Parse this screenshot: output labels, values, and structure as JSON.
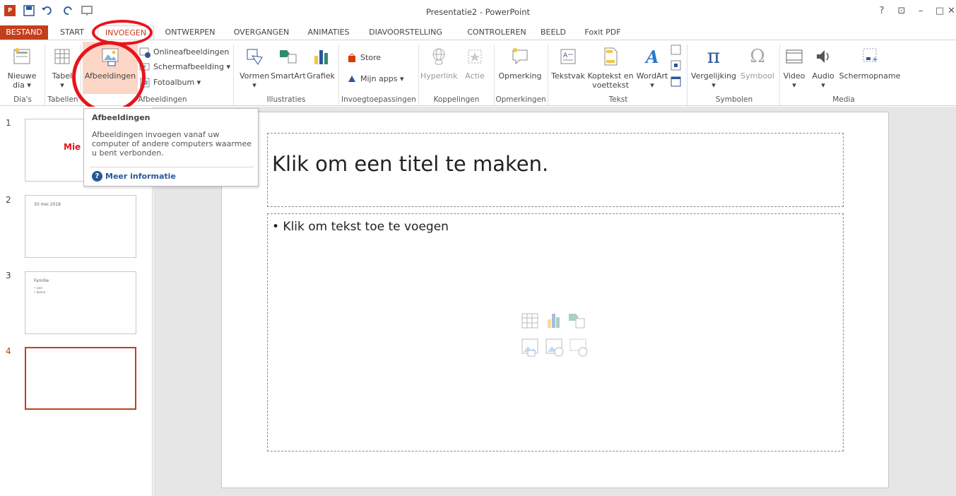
{
  "window": {
    "title": "Presentatie2 - PowerPoint",
    "help": "?",
    "ribbon_display": "⊡",
    "minimize": "–",
    "restore": "□",
    "close": "✕"
  },
  "overlay": {
    "partial_heading": ""
  },
  "tabs": [
    {
      "label": "BESTAND"
    },
    {
      "label": "START"
    },
    {
      "label": "INVOEGEN"
    },
    {
      "label": "ONTWERPEN"
    },
    {
      "label": "OVERGANGEN"
    },
    {
      "label": "ANIMATIES"
    },
    {
      "label": "DIAVOORSTELLING"
    },
    {
      "label": "CONTROLEREN"
    },
    {
      "label": "BEELD"
    },
    {
      "label": "Foxit PDF"
    }
  ],
  "ribbon": {
    "slides": {
      "new_slide": "Nieuwe",
      "new_slide2": "dia ▾",
      "group": "Dia's"
    },
    "tables": {
      "table": "Tabel",
      "table2": "▾",
      "group": "Tabellen"
    },
    "images": {
      "pictures": "Afbeeldingen",
      "online": "Onlineafbeeldingen",
      "screenshot": "Schermafbeelding ▾",
      "album": "Fotoalbum ▾",
      "group": "Afbeeldingen"
    },
    "illustrations": {
      "shapes": "Vormen",
      "shapes2": "▾",
      "smartart": "SmartArt",
      "chart": "Grafiek",
      "group": "Illustraties"
    },
    "apps": {
      "store": "Store",
      "myapps": "Mijn apps ▾",
      "group": "Invoegtoepassingen"
    },
    "links": {
      "hyperlink": "Hyperlink",
      "action": "Actie",
      "group": "Koppelingen"
    },
    "comments": {
      "comment": "Opmerking",
      "group": "Opmerkingen"
    },
    "text": {
      "textbox": "Tekstvak",
      "header": "Koptekst en",
      "header2": "voettekst",
      "wordart": "WordArt",
      "wordart2": "▾",
      "group": "Tekst"
    },
    "symbols": {
      "equation": "Vergelijking",
      "equation2": "▾",
      "symbol": "Symbool",
      "group": "Symbolen"
    },
    "media": {
      "video": "Video",
      "video2": "▾",
      "audio": "Audio",
      "audio2": "▾",
      "screenrec": "Schermopname",
      "group": "Media"
    }
  },
  "tooltip": {
    "title": "Afbeeldingen",
    "body": "Afbeeldingen invoegen vanaf uw computer of andere computers waarmee u bent verbonden.",
    "more": "Meer informatie"
  },
  "thumbnails": [
    {
      "num": "1",
      "text": "Mie"
    },
    {
      "num": "2",
      "text": "30 mei 2018"
    },
    {
      "num": "3",
      "text": "Familie",
      "bullet1": "• Lien",
      "bullet2": "• Sanne"
    },
    {
      "num": "4",
      "text": ""
    }
  ],
  "slide": {
    "title_placeholder": "Klik om een titel te maken.",
    "body_placeholder": "• Klik om tekst toe te voegen"
  },
  "colors": {
    "accent": "#c43e1c",
    "annotation": "#e8141c",
    "link": "#2b579a"
  }
}
